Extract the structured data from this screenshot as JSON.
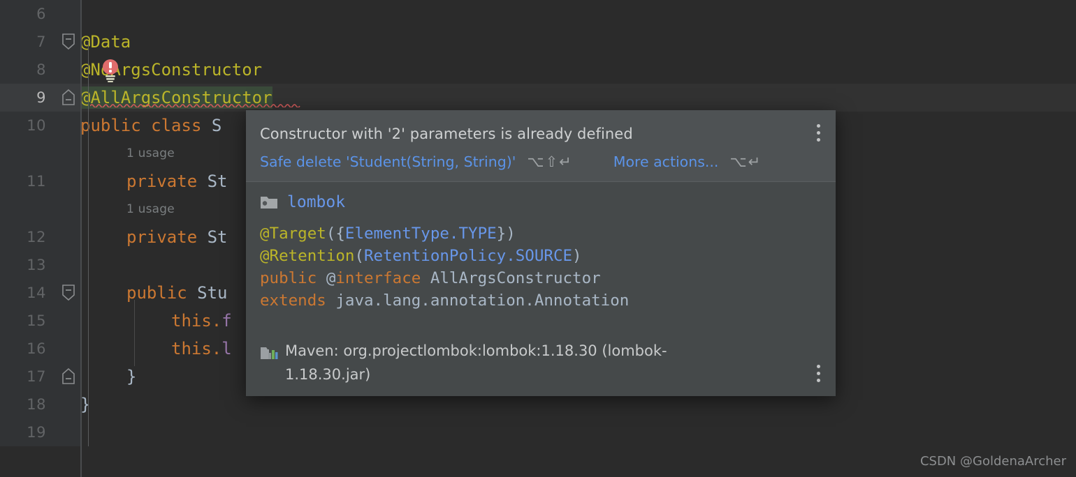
{
  "editor": {
    "theme_background": "#2b2b2b",
    "gutter_background": "#313335",
    "current_line": 9,
    "lines": [
      {
        "number": "6",
        "code": "",
        "inlay": ""
      },
      {
        "number": "7",
        "code": "@Data",
        "inlay": ""
      },
      {
        "number": "8",
        "code": "@NoArgsConstructor",
        "inlay": ""
      },
      {
        "number": "9",
        "code": "@AllArgsConstructor",
        "inlay": ""
      },
      {
        "number": "10",
        "code": "public class S",
        "inlay": ""
      },
      {
        "number": "",
        "code": "",
        "inlay": "1 usage"
      },
      {
        "number": "11",
        "code": "private St",
        "inlay": ""
      },
      {
        "number": "",
        "code": "",
        "inlay": "1 usage"
      },
      {
        "number": "12",
        "code": "private St",
        "inlay": ""
      },
      {
        "number": "13",
        "code": "",
        "inlay": ""
      },
      {
        "number": "14",
        "code": "public Stu",
        "inlay": ""
      },
      {
        "number": "15",
        "code": "this.f",
        "inlay": ""
      },
      {
        "number": "16",
        "code": "this.l",
        "inlay": ""
      },
      {
        "number": "17",
        "code": "}",
        "inlay": ""
      },
      {
        "number": "18",
        "code": "}",
        "inlay": ""
      },
      {
        "number": "19",
        "code": "",
        "inlay": ""
      }
    ],
    "highlighted_identifier": "@AllArgsConstructor",
    "error_icon": "lightbulb-error-icon"
  },
  "popup": {
    "title": "Constructor with '2' parameters is already defined",
    "primary_action": {
      "label": "Safe delete 'Student(String, String)'",
      "shortcut": "⌥⇧↵"
    },
    "secondary_action": {
      "label": "More actions...",
      "shortcut": "⌥↵"
    },
    "package": {
      "icon": "package-folder-icon",
      "name": "lombok"
    },
    "doc": {
      "line1_anno": "@Target",
      "line1_open": "({",
      "line1_value": "ElementType.TYPE",
      "line1_close": "})",
      "line2_anno": "@Retention",
      "line2_open": "(",
      "line2_value": "RetentionPolicy.SOURCE",
      "line2_close": ")",
      "line3_kw1": "public",
      "line3_at": "@",
      "line3_kw2": "interface",
      "line3_name": "AllArgsConstructor",
      "line4_kw": "extends",
      "line4_type": "java.lang.annotation.Annotation"
    },
    "footer": {
      "icon": "maven-library-icon",
      "text": "Maven: org.projectlombok:lombok:1.18.30 (lombok-1.18.30.jar)"
    },
    "menu_icon": "vertical-dots-icon"
  },
  "watermark": "CSDN @GoldenaArcher"
}
